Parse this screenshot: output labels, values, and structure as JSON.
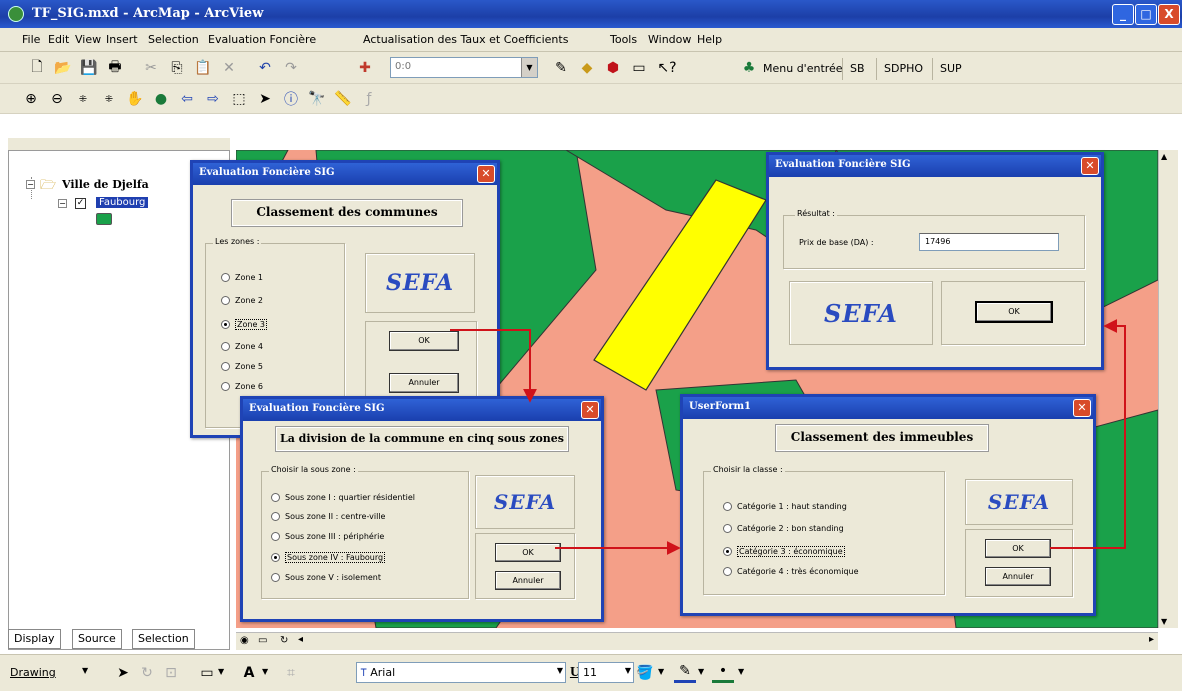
{
  "window": {
    "title": "TF_SIG.mxd - ArcMap - ArcView",
    "controls": [
      "_",
      "□",
      "X"
    ]
  },
  "menu": [
    "File",
    "Edit",
    "View",
    "Insert",
    "Selection",
    "Evaluation Foncière",
    "Actualisation des Taux et Coefficients",
    "Tools",
    "Window",
    "Help"
  ],
  "toolbar": {
    "scale_value": "0:0",
    "menu_entree": "Menu d'entrée",
    "sb": "SB",
    "sdpho": "SDPHO",
    "sup": "SUP"
  },
  "toc": {
    "root_layer": "Ville de Djelfa",
    "sub_layer": "Faubourg",
    "tabs": [
      "Display",
      "Source",
      "Selection"
    ]
  },
  "drawing": {
    "drawing_label": "Drawing",
    "font_name": "Arial",
    "font_size": "11",
    "bold": "B",
    "italic": "I",
    "underline": "U"
  },
  "colors": {
    "map_background": "#f49f88",
    "zone_green": "#1aa14a",
    "zone_yellow": "#ffff00",
    "arrow_red": "#d0121a"
  },
  "dialog_communes": {
    "title": "Evaluation Foncière SIG",
    "heading": "Classement des communes",
    "group_label": "Les zones :",
    "options": [
      "Zone 1",
      "Zone 2",
      "Zone 3",
      "Zone 4",
      "Zone 5",
      "Zone 6"
    ],
    "selected": 2,
    "logo": "SEFA",
    "ok": "OK",
    "cancel": "Annuler"
  },
  "dialog_souszones": {
    "title": "Evaluation Foncière SIG",
    "heading": "La division de la commune en cinq sous zones",
    "group_label": "Choisir la sous zone :",
    "options": [
      "Sous zone I  : quartier résidentiel",
      "Sous zone II  : centre-ville",
      "Sous zone III : périphérie",
      "Sous zone IV : Faubourg",
      "Sous zone V  : isolement"
    ],
    "selected": 3,
    "logo": "SEFA",
    "ok": "OK",
    "cancel": "Annuler"
  },
  "dialog_immeubles": {
    "title": "UserForm1",
    "heading": "Classement des immeubles",
    "group_label": "Choisir la classe :",
    "options": [
      "Catégorie 1 : haut standing",
      "Catégorie 2 : bon standing",
      "Catégorie 3 : économique",
      "Catégorie 4 : très économique"
    ],
    "selected": 2,
    "logo": "SEFA",
    "ok": "OK",
    "cancel": "Annuler"
  },
  "dialog_resultat": {
    "title": "Evaluation Foncière SIG",
    "group_label": "Résultat :",
    "price_label": "Prix de base (DA) :",
    "price_value": "17496",
    "logo": "SEFA",
    "ok": "OK"
  }
}
